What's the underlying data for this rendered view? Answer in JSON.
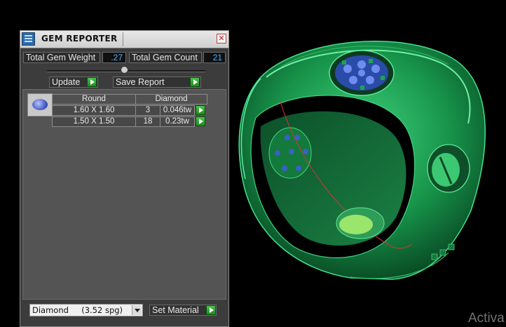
{
  "panel": {
    "title": "GEM REPORTER",
    "close_label": "✕",
    "total_gem_weight_label": "Total Gem Weight",
    "total_gem_weight_value": ".27",
    "total_gem_count_label": "Total Gem Count",
    "total_gem_count_value": "21",
    "update_label": "Update",
    "save_report_label": "Save Report",
    "table": {
      "headers": [
        "Round",
        "Diamond"
      ],
      "rows": [
        {
          "size": "1.60 X 1.60",
          "count": "3",
          "weight": "0.046tw"
        },
        {
          "size": "1.50 X 1.50",
          "count": "18",
          "weight": "0.23tw"
        }
      ]
    },
    "material_select": "Diamond     (3.52 spg)",
    "set_material_label": "Set Material"
  },
  "watermark": "Activa",
  "icons": {
    "app": "gem-reporter-app-icon",
    "close": "close-icon",
    "go": "green-play-arrow-icon",
    "gem": "round-gem-icon",
    "dropdown": "chevron-down-icon"
  },
  "colors": {
    "ring_green": "#1fa352",
    "value_blue": "#4ab0ff",
    "button_green": "#2ea82e"
  }
}
